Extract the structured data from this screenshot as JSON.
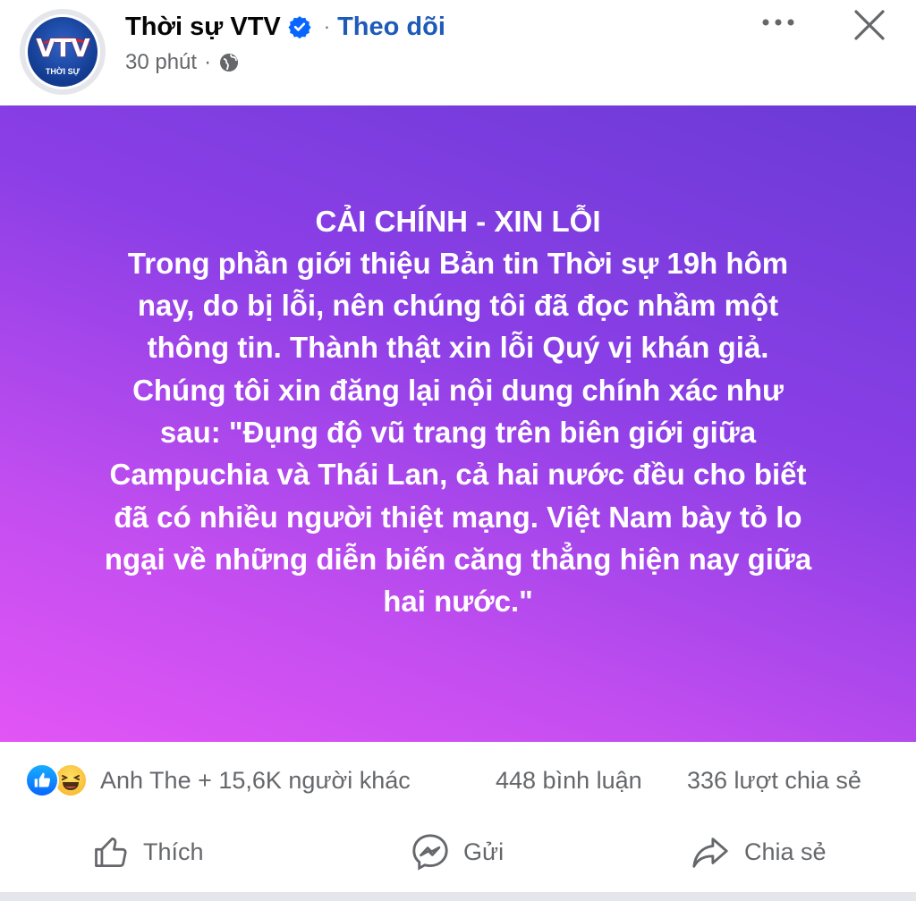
{
  "post": {
    "page_name": "Thời sự VTV",
    "follow_label": "Theo dõi",
    "separator": "·",
    "time": "30 phút",
    "time_separator": "·",
    "avatar_logo": "VTV",
    "avatar_sub": "THỜI SỰ",
    "icons": {
      "verified": "verified-badge-icon",
      "globe": "globe-icon",
      "more": "more-options-icon",
      "close": "close-icon"
    }
  },
  "banner": {
    "lines": [
      "CẢI CHÍNH - XIN LỖI",
      "Trong phần giới thiệu Bản tin Thời sự 19h hôm",
      "nay, do bị lỗi, nên chúng tôi đã đọc nhầm một",
      "thông tin. Thành thật xin lỗi Quý vị khán giả.",
      "Chúng tôi xin đăng lại nội dung chính xác như",
      "sau: \"Đụng độ vũ trang trên biên giới giữa",
      "Campuchia và Thái Lan, cả hai nước đều cho biết",
      "đã có nhiều người thiệt mạng. Việt Nam bày tỏ lo",
      "ngại về những diễn biến căng thẳng hiện nay giữa",
      "hai nước.\""
    ],
    "colors": {
      "start": "#6a3ad6",
      "end": "#e255f5"
    }
  },
  "stats": {
    "reactions": "Anh The + 15,6K người khác",
    "comments": "448 bình luận",
    "shares": "336 lượt chia sẻ"
  },
  "actions": {
    "like": "Thích",
    "send": "Gửi",
    "share": "Chia sẻ"
  },
  "colors": {
    "accent": "#1e5bb8",
    "verified": "#0866ff",
    "muted": "#65676b"
  }
}
